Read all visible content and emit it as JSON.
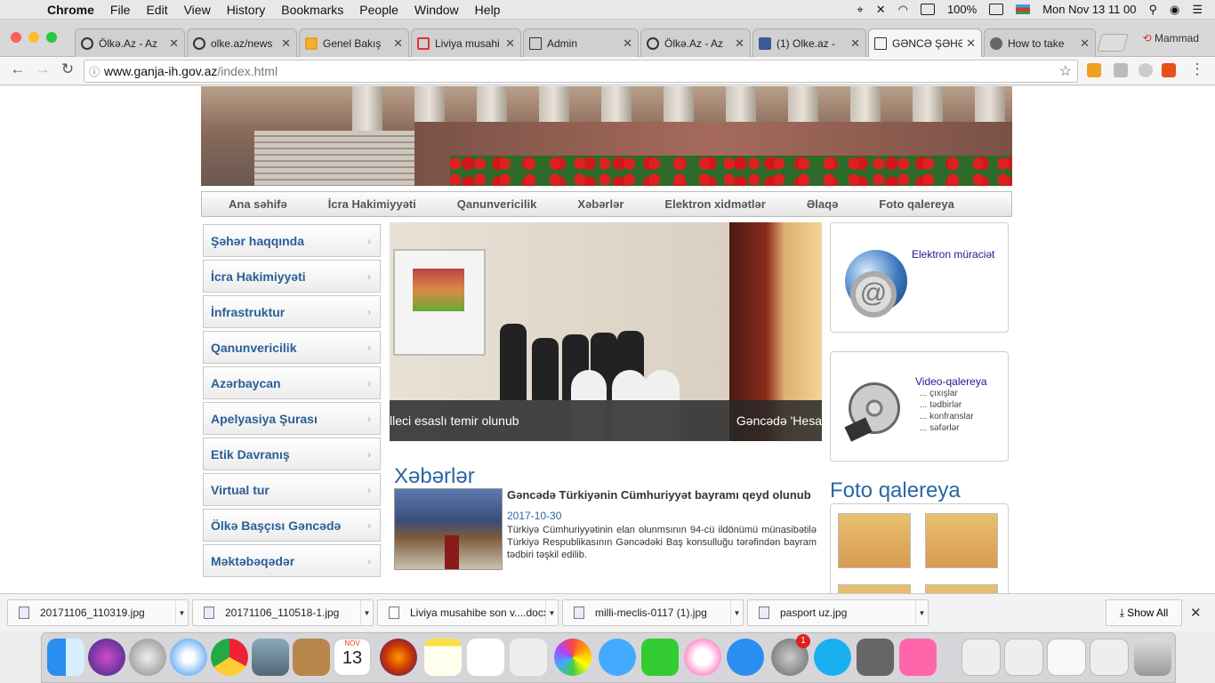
{
  "menubar": {
    "app": "Chrome",
    "items": [
      "File",
      "Edit",
      "View",
      "History",
      "Bookmarks",
      "People",
      "Window",
      "Help"
    ],
    "battery": "100%",
    "clock": "Mon Nov 13  11 00"
  },
  "tabs": [
    {
      "title": "Ölkə.Az - Az"
    },
    {
      "title": "olke.az/news"
    },
    {
      "title": "Genel Bakış"
    },
    {
      "title": "Liviya musahi"
    },
    {
      "title": "Admin"
    },
    {
      "title": "Ölkə.Az - Az"
    },
    {
      "title": "(1) Olke.az -"
    },
    {
      "title": "GƏNCƏ ŞƏHƏ"
    },
    {
      "title": "How to take"
    }
  ],
  "profile": "Mammad",
  "address": {
    "host": "www.ganja-ih.gov.az",
    "path": "/index.html"
  },
  "topnav": [
    "Ana səhifə",
    "İcra Hakimiyyəti",
    "Qanunvericilik",
    "Xəbərlər",
    "Elektron xidmətlər",
    "Əlaqə",
    "Foto qalereya"
  ],
  "sidemenu": [
    "Şəhər haqqında",
    "İcra Hakimiyyəti",
    "İnfrastruktur",
    "Qanunvericilik",
    "Azərbaycan",
    "Apelyasiya Şurası",
    "Etik Davranış",
    "Virtual tur",
    "Ölkə Başçısı Gəncədə",
    "Məktəbəqədər"
  ],
  "slider": {
    "caption_left": "lleci esaslı temir olunub",
    "caption_right": "Gəncədə 'Hesa"
  },
  "eservice": {
    "title": "Elektron müraciət",
    "icon": "@"
  },
  "video": {
    "title": "Video-qalereya",
    "items": [
      "... çıxışlar",
      "... tədbirlər",
      "... konfranslar",
      "... səfərlər"
    ]
  },
  "news_section": "Xəbərlər",
  "photo_section": "Foto qalereya",
  "news": {
    "title": "Gəncədə Türkiyənin Cümhuriyyət bayramı qeyd olunub",
    "date": "2017-10-30",
    "text": "Türkiyə Cümhuriyyətinin elan olunmsının 94-cü ildönümü münasibətilə Türkiyə Respublikasının Gəncədəki Baş konsulluğu tərəfindən bayram tədbiri təşkil edilib."
  },
  "downloads": [
    "20171106_110319.jpg",
    "20171106_110518-1.jpg",
    "Liviya musahibe son v....docx",
    "milli-meclis-0117 (1).jpg",
    "pasport uz.jpg"
  ],
  "show_all": "Show All",
  "dock": {
    "calendar_month": "NOV",
    "calendar_day": "13",
    "badge": "1"
  }
}
